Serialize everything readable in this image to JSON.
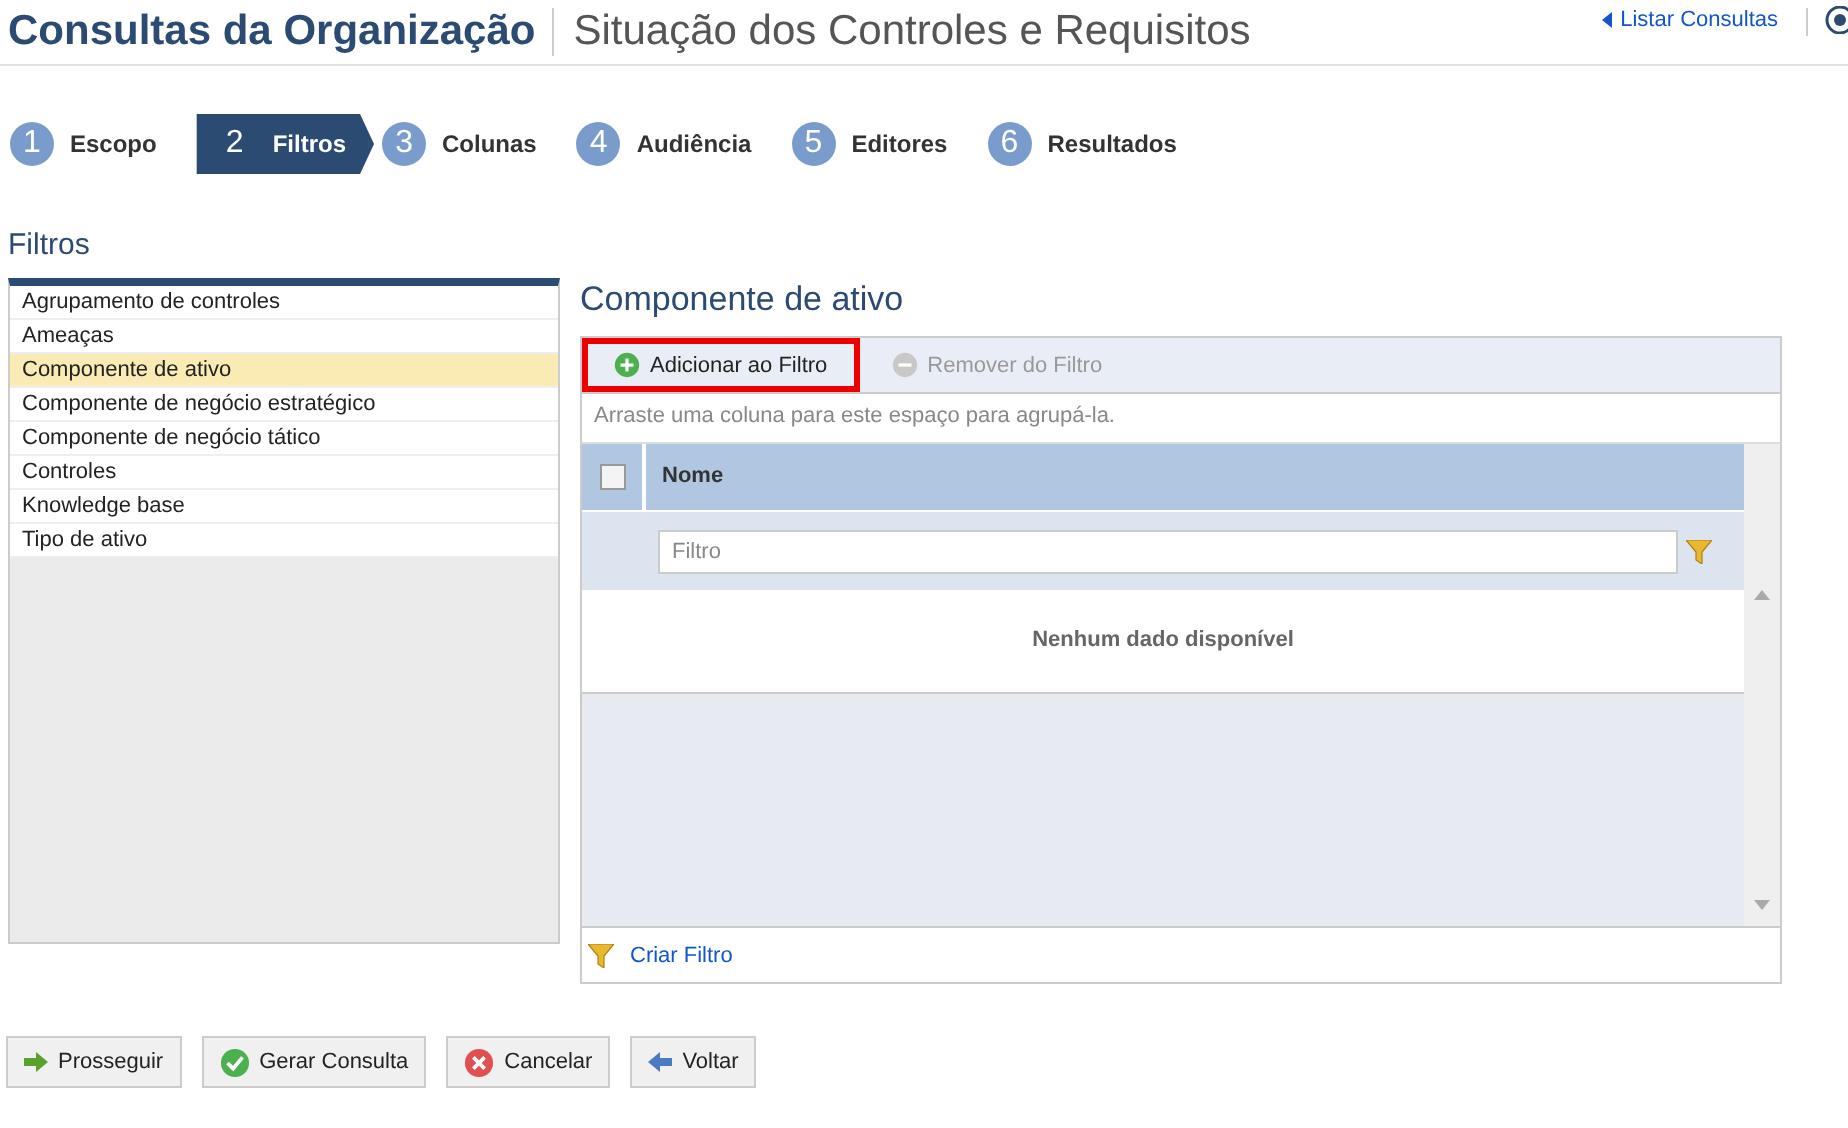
{
  "header": {
    "title": "Consultas da Organização",
    "subtitle": "Situação dos Controles e Requisitos",
    "link": "Listar Consultas"
  },
  "steps": [
    {
      "number": "1",
      "label": "Escopo",
      "selected": false
    },
    {
      "number": "2",
      "label": "Filtros",
      "selected": true
    },
    {
      "number": "3",
      "label": "Colunas",
      "selected": false
    },
    {
      "number": "4",
      "label": "Audiência",
      "selected": false
    },
    {
      "number": "5",
      "label": "Editores",
      "selected": false
    },
    {
      "number": "6",
      "label": "Resultados",
      "selected": false
    }
  ],
  "section_title": "Filtros",
  "filter_list": [
    {
      "label": "Agrupamento de controles",
      "selected": false
    },
    {
      "label": "Ameaças",
      "selected": false
    },
    {
      "label": "Componente de ativo",
      "selected": true
    },
    {
      "label": "Componente de negócio estratégico",
      "selected": false
    },
    {
      "label": "Componente de negócio tático",
      "selected": false
    },
    {
      "label": "Controles",
      "selected": false
    },
    {
      "label": "Knowledge base",
      "selected": false
    },
    {
      "label": "Tipo de ativo",
      "selected": false
    }
  ],
  "panel": {
    "title": "Componente de ativo",
    "toolbar": [
      {
        "kind": "add",
        "label": "Adicionar ao Filtro",
        "disabled": false,
        "highlighted": true
      },
      {
        "kind": "remove",
        "label": "Remover do Filtro",
        "disabled": true,
        "highlighted": false
      }
    ],
    "group_hint": "Arraste uma coluna para este espaço para agrupá-la.",
    "columns": [
      {
        "label": "Nome"
      }
    ],
    "select_all_checked": false,
    "filter_placeholder": "Filtro",
    "empty_message": "Nenhum dado disponível",
    "footer_link": "Criar Filtro"
  },
  "buttons": [
    {
      "kind": "proceed",
      "label": "Prosseguir"
    },
    {
      "kind": "generate",
      "label": "Gerar Consulta"
    },
    {
      "kind": "cancel",
      "label": "Cancelar"
    },
    {
      "kind": "back",
      "label": "Voltar"
    }
  ]
}
